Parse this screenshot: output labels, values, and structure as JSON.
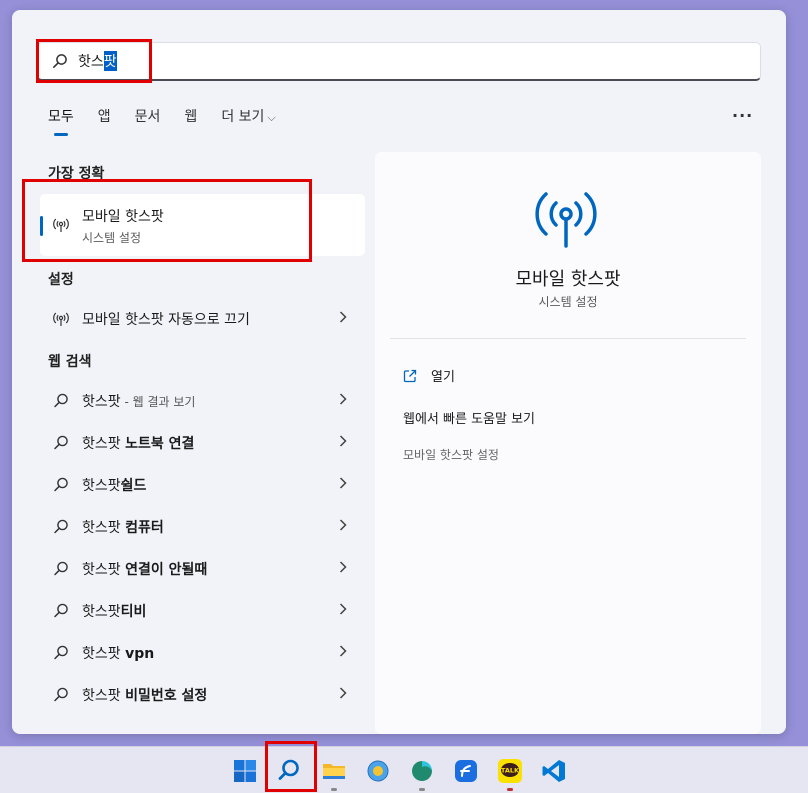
{
  "search": {
    "query_plain": "핫스",
    "query_selected": "팟"
  },
  "tabs": [
    {
      "label": "모두"
    },
    {
      "label": "앱"
    },
    {
      "label": "문서"
    },
    {
      "label": "웹"
    },
    {
      "label": "더 보기"
    }
  ],
  "more_label": "···",
  "sections": {
    "best_match": "가장 정확",
    "settings": "설정",
    "web_search": "웹 검색"
  },
  "best_match": {
    "title": "모바일 핫스팟",
    "subtitle": "시스템 설정"
  },
  "settings_items": [
    {
      "label": "모바일 핫스팟 자동으로 끄기"
    }
  ],
  "web_items": [
    {
      "base": "핫스팟",
      "bold": "",
      "suffix": " - 웹 결과 보기"
    },
    {
      "base": "핫스팟 ",
      "bold": "노트북 연결",
      "suffix": ""
    },
    {
      "base": "핫스팟",
      "bold": "쉴드",
      "suffix": ""
    },
    {
      "base": "핫스팟 ",
      "bold": "컴퓨터",
      "suffix": ""
    },
    {
      "base": "핫스팟 ",
      "bold": "연결이 안될때",
      "suffix": ""
    },
    {
      "base": "핫스팟",
      "bold": "티비",
      "suffix": ""
    },
    {
      "base": "핫스팟 ",
      "bold": "vpn",
      "suffix": ""
    },
    {
      "base": "핫스팟 ",
      "bold": "비밀번호 설정",
      "suffix": ""
    }
  ],
  "preview": {
    "title": "모바일 핫스팟",
    "subtitle": "시스템 설정",
    "actions": [
      {
        "label": "열기"
      },
      {
        "label": "웹에서 빠른 도움말 보기"
      },
      {
        "label": "모바일 핫스팟 설정"
      }
    ]
  },
  "taskbar": {
    "talk_label": "TALK"
  },
  "colors": {
    "accent": "#0067c0",
    "highlight_box": "#e00000",
    "wallpaper": "#9590d8"
  },
  "icons": [
    "search-icon",
    "hotspot-icon",
    "chevron-right-icon",
    "open-external-icon",
    "windows-start-icon",
    "file-explorer-icon",
    "browser-icon",
    "kakaotalk-icon",
    "vscode-icon"
  ]
}
